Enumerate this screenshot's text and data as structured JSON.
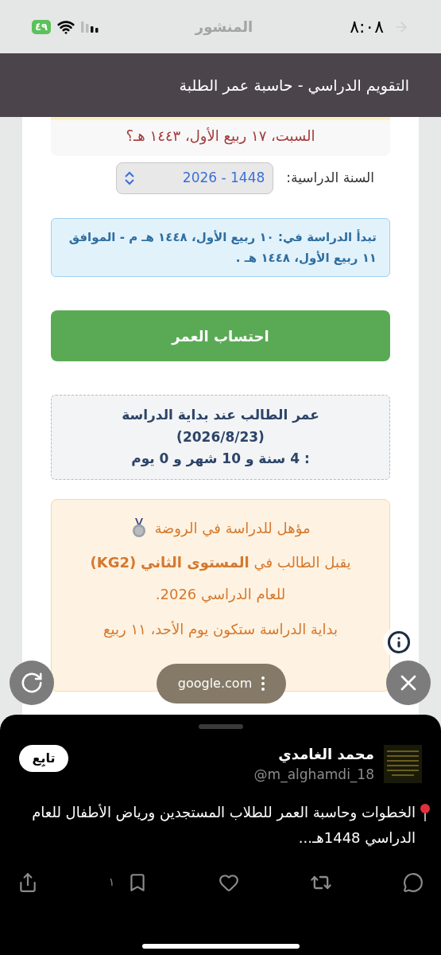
{
  "status_bar": {
    "time": "٨:٠٨",
    "battery": "٤٩",
    "header_title": "المنشور"
  },
  "page_title": "التقويم الدراسي - حاسبة عمر الطلبة",
  "date_question": "السبت، ١٧ ربيع الأول، ١٤٤٣ هـ؟",
  "year_field": {
    "label": "السنة الدراسية:",
    "value": "2026 - 1448"
  },
  "start_info": "تبدأ الدراسة في: ١٠ ربيع الأول، ١٤٤٨ هـ م - الموافق ١١ ربيع الأول، ١٤٤٨ هـ .",
  "calculate_button": "احتساب العمر",
  "result": {
    "title": "عمر الطالب عند بداية الدراسة",
    "date": "(2026/8/23)",
    "age": ": 4 سنة و 10 شهر و 0 يوم"
  },
  "eligibility": {
    "heading": "مؤهل للدراسة في الروضة",
    "level_text": "يقبل الطالب في **المستوى الثاني** **(KG2)** للعام الدراسي 2026.",
    "start_text": "بداية الدراسة ستكون يوم الأحد، ١١ ربيع"
  },
  "browser_overlay": {
    "url": "google.com"
  },
  "post": {
    "author": "محمد الغامدي",
    "handle": "@m_alghamdi_18",
    "follow": "تابِع",
    "text": "الخطوات وحاسبة العمر للطلاب المستجدين ورياض الأطفال للعام الدراسي  1448هـ...",
    "bookmark_count": "١"
  }
}
